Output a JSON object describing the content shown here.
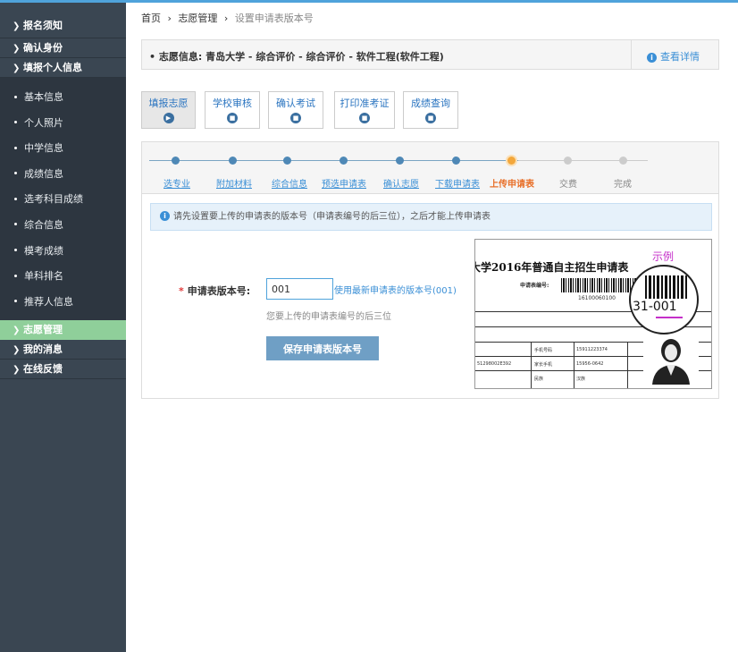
{
  "sidebar": {
    "sections_top": [
      "报名须知",
      "确认身份",
      "填报个人信息"
    ],
    "sub_items": [
      "基本信息",
      "个人照片",
      "中学信息",
      "成绩信息",
      "选考科目成绩",
      "综合信息",
      "模考成绩",
      "单科排名",
      "推荐人信息"
    ],
    "sections_bottom": [
      "志愿管理",
      "我的消息",
      "在线反馈"
    ],
    "active_section": "志愿管理"
  },
  "breadcrumb": {
    "home": "首页",
    "level2": "志愿管理",
    "current": "设置申请表版本号",
    "sep": "›"
  },
  "info": {
    "text": "志愿信息:  青岛大学 - 综合评价 - 综合评价 - 软件工程(软件工程)",
    "detail_link": "查看详情"
  },
  "tabs": [
    "填报志愿",
    "学校审核",
    "确认考试",
    "打印准考证",
    "成绩查询"
  ],
  "steps": {
    "labels": [
      "选专业",
      "附加材料",
      "综合信息",
      "预选申请表",
      "确认志愿",
      "下载申请表",
      "上传申请表",
      "交费",
      "完成"
    ],
    "current_index": 6
  },
  "notice": "请先设置要上传的申请表的版本号（申请表编号的后三位），之后才能上传申请表",
  "form": {
    "label": "申请表版本号:",
    "required_mark": "*",
    "value": "001",
    "use_latest": "使用最新申请表的版本号(001)",
    "hint": "您要上传的申请表编号的后三位",
    "save_button": "保存申请表版本号"
  },
  "example": {
    "badge": "示例",
    "title": "大学2016年普通自主招生申请表",
    "code_label": "申请表编号:",
    "barcode_number": "16100060100",
    "zoom_number": "31-001",
    "cells": [
      "手机号码",
      "15911223374",
      "家长手机",
      "15956-0642",
      "民族",
      "汉族",
      "51298002E392"
    ]
  },
  "colors": {
    "sidebar_bg": "#3a4652",
    "sidebar_active": "#8fcf9a",
    "accent_blue": "#3a8fd6",
    "current_step": "#e8702a",
    "button": "#6f9fc5"
  },
  "icons": {
    "chevron": "chevron-right-icon",
    "info": "info-icon",
    "tab_play": "play-circle-icon",
    "tab_lock": "lock-circle-icon"
  }
}
